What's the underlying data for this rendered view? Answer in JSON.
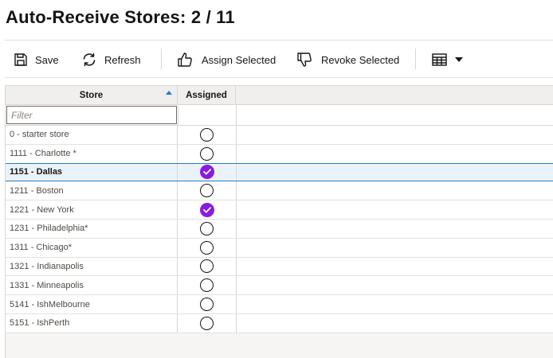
{
  "page": {
    "title": "Auto-Receive Stores: 2 / 11"
  },
  "toolbar": {
    "save_label": "Save",
    "refresh_label": "Refresh",
    "assign_label": "Assign Selected",
    "revoke_label": "Revoke Selected",
    "icons": {
      "save": "floppy-disk-icon",
      "refresh": "refresh-icon",
      "assign": "thumbs-up-icon",
      "revoke": "thumbs-down-icon",
      "view": "table-grid-icon",
      "view_menu": "caret-down-icon"
    }
  },
  "grid": {
    "columns": {
      "store": "Store",
      "assigned": "Assigned"
    },
    "sort": {
      "column": "Store",
      "direction": "ascending"
    },
    "filter_placeholder": "Filter",
    "filter_value": "",
    "rows": [
      {
        "store": "0 - starter store",
        "assigned": false,
        "selected": false
      },
      {
        "store": "1111 - Charlotte *",
        "assigned": false,
        "selected": false
      },
      {
        "store": "1151 - Dallas",
        "assigned": true,
        "selected": true
      },
      {
        "store": "1211 - Boston",
        "assigned": false,
        "selected": false
      },
      {
        "store": "1221 - New York",
        "assigned": true,
        "selected": false
      },
      {
        "store": "1231 - Philadelphia*",
        "assigned": false,
        "selected": false
      },
      {
        "store": "1311 - Chicago*",
        "assigned": false,
        "selected": false
      },
      {
        "store": "1321 - Indianapolis",
        "assigned": false,
        "selected": false
      },
      {
        "store": "1331 - Minneapolis",
        "assigned": false,
        "selected": false
      },
      {
        "store": "5141 - IshMelbourne",
        "assigned": false,
        "selected": false
      },
      {
        "store": "5151 - IshPerth",
        "assigned": false,
        "selected": false
      }
    ]
  },
  "colors": {
    "checked": "#8a1ae0",
    "sort_indicator": "#227bc6",
    "selected_row": "#ebf3fa"
  }
}
